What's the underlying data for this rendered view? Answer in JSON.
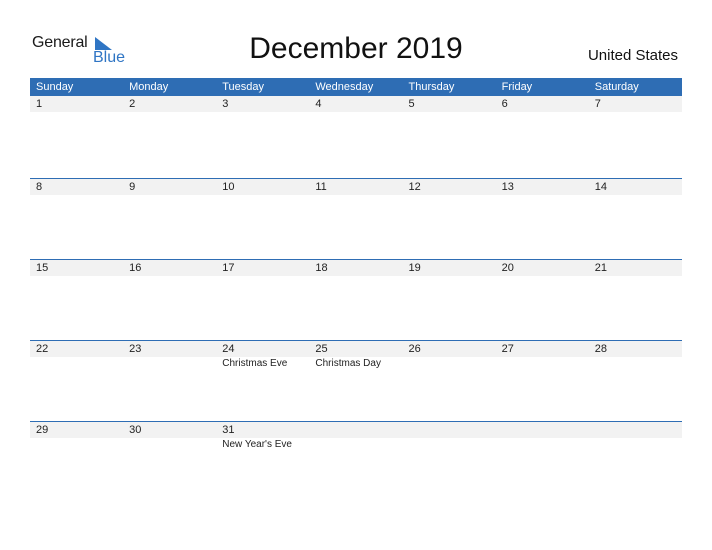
{
  "logo": {
    "general": "General",
    "blue": "Blue"
  },
  "title": "December 2019",
  "country": "United States",
  "colors": {
    "header": "#2E6DB4",
    "date_strip": "#F2F2F2",
    "logo_blue": "#2F75C4"
  },
  "weekdays": [
    "Sunday",
    "Monday",
    "Tuesday",
    "Wednesday",
    "Thursday",
    "Friday",
    "Saturday"
  ],
  "weeks": [
    [
      {
        "d": "1",
        "h": ""
      },
      {
        "d": "2",
        "h": ""
      },
      {
        "d": "3",
        "h": ""
      },
      {
        "d": "4",
        "h": ""
      },
      {
        "d": "5",
        "h": ""
      },
      {
        "d": "6",
        "h": ""
      },
      {
        "d": "7",
        "h": ""
      }
    ],
    [
      {
        "d": "8",
        "h": ""
      },
      {
        "d": "9",
        "h": ""
      },
      {
        "d": "10",
        "h": ""
      },
      {
        "d": "11",
        "h": ""
      },
      {
        "d": "12",
        "h": ""
      },
      {
        "d": "13",
        "h": ""
      },
      {
        "d": "14",
        "h": ""
      }
    ],
    [
      {
        "d": "15",
        "h": ""
      },
      {
        "d": "16",
        "h": ""
      },
      {
        "d": "17",
        "h": ""
      },
      {
        "d": "18",
        "h": ""
      },
      {
        "d": "19",
        "h": ""
      },
      {
        "d": "20",
        "h": ""
      },
      {
        "d": "21",
        "h": ""
      }
    ],
    [
      {
        "d": "22",
        "h": ""
      },
      {
        "d": "23",
        "h": ""
      },
      {
        "d": "24",
        "h": "Christmas Eve"
      },
      {
        "d": "25",
        "h": "Christmas Day"
      },
      {
        "d": "26",
        "h": ""
      },
      {
        "d": "27",
        "h": ""
      },
      {
        "d": "28",
        "h": ""
      }
    ],
    [
      {
        "d": "29",
        "h": ""
      },
      {
        "d": "30",
        "h": ""
      },
      {
        "d": "31",
        "h": "New Year's Eve"
      }
    ]
  ]
}
